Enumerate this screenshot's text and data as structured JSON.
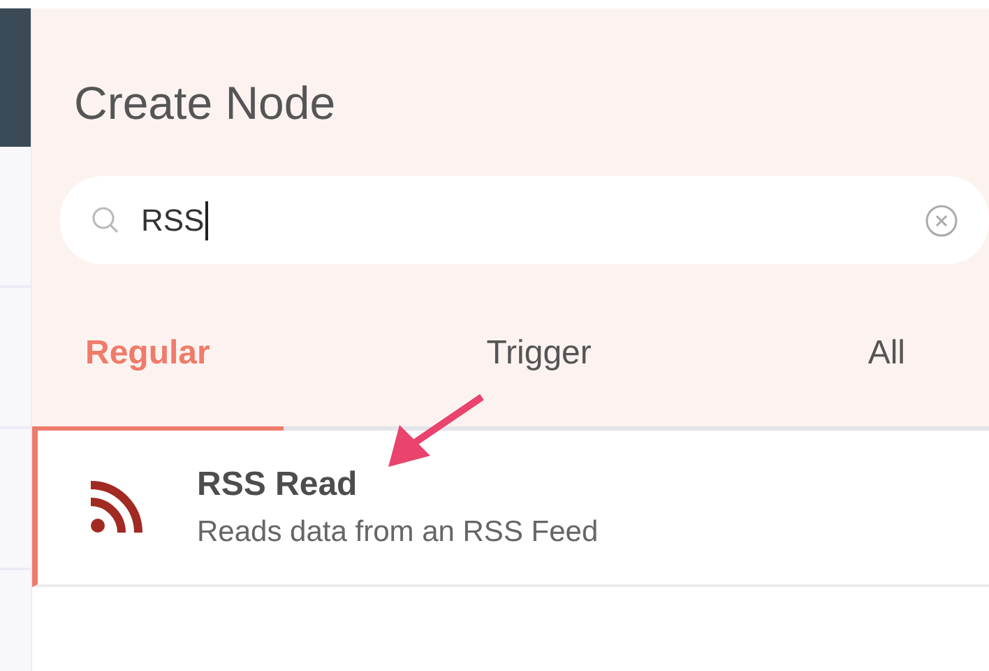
{
  "panel": {
    "title": "Create Node"
  },
  "search": {
    "value": "RSS"
  },
  "tabs": [
    {
      "label": "Regular",
      "selected": true
    },
    {
      "label": "Trigger",
      "selected": false
    },
    {
      "label": "All",
      "selected": false
    }
  ],
  "nodes": [
    {
      "name": "RSS Read",
      "description": "Reads data from an RSS Feed",
      "selected": true
    }
  ]
}
